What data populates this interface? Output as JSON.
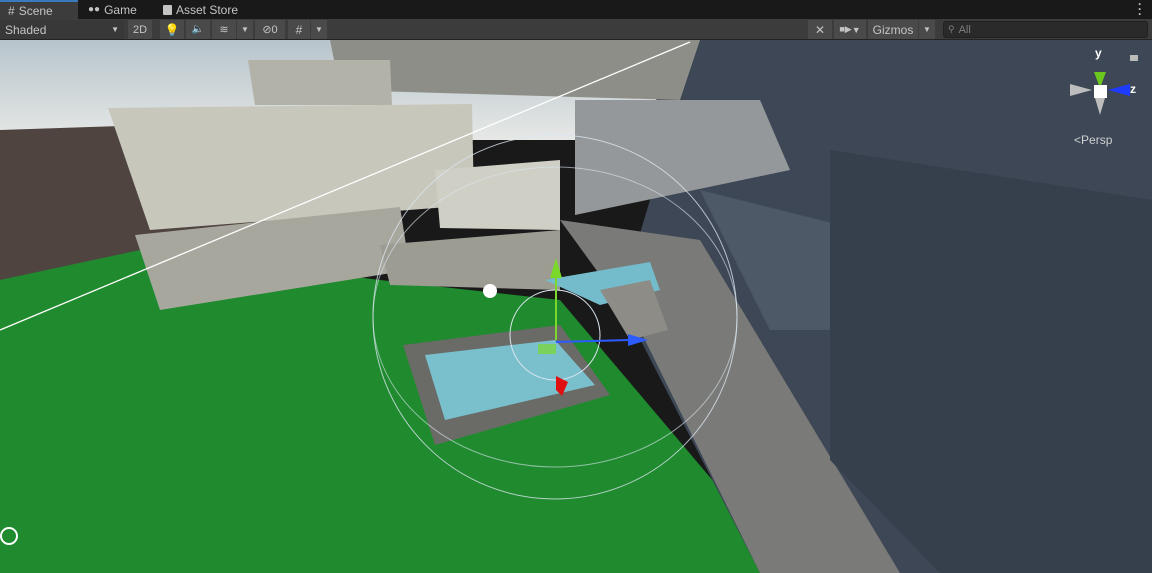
{
  "tabs": [
    {
      "label": "Scene",
      "icon": "grid-icon",
      "active": true
    },
    {
      "label": "Game",
      "icon": "gamepad-icon"
    },
    {
      "label": "Asset Store",
      "icon": "shopping-bag-icon"
    }
  ],
  "toolbar": {
    "draw_mode": "Shaded",
    "mode_2d": "2D",
    "hidden_count": "0",
    "gizmos": "Gizmos",
    "search_placeholder": "All"
  },
  "gizmo": {
    "y_label": "y",
    "z_label": "z",
    "projection": "Persp"
  },
  "colors": {
    "accent": "#3a79bb",
    "ground": "#1f8a2e",
    "water": "#6fc6d6"
  }
}
